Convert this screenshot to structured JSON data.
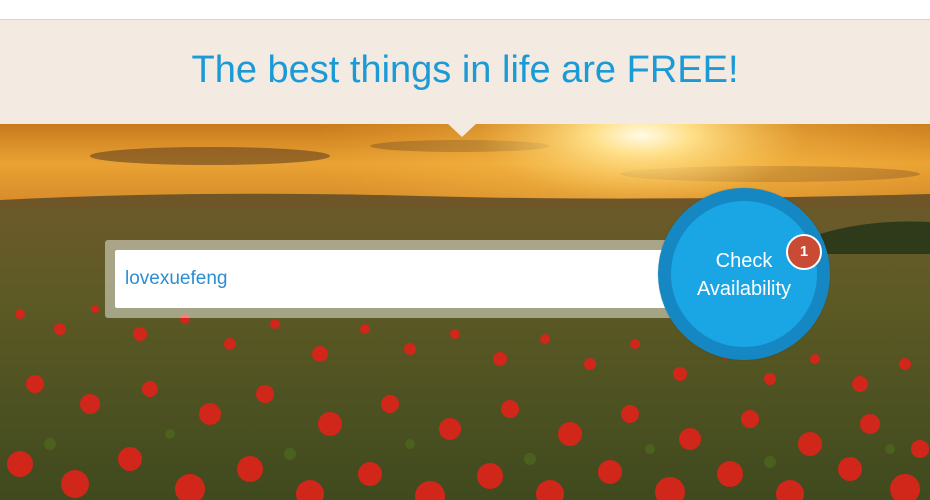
{
  "banner": {
    "headline": "The best things in life are FREE!"
  },
  "search": {
    "value": "lovexuefeng",
    "placeholder": ""
  },
  "check_button": {
    "line1": "Check",
    "line2": "Availability"
  },
  "badge": {
    "count": "1"
  },
  "colors": {
    "accent": "#1aa6e4",
    "headline": "#1a9ad6",
    "banner_bg": "#f3eae1",
    "badge": "#c94a35"
  },
  "hero": {
    "image": "sunset-poppy-field"
  }
}
